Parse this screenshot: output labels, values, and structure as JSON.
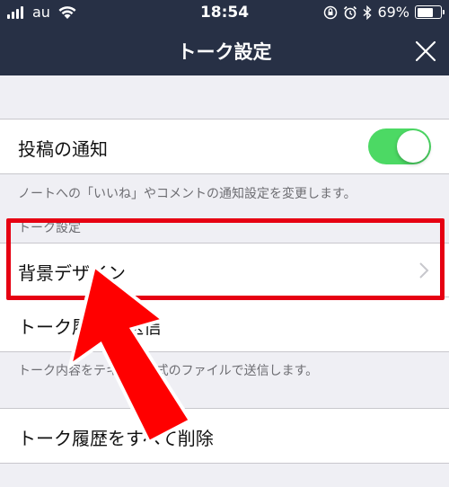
{
  "status_bar": {
    "carrier": "au",
    "time": "18:54",
    "battery": "69%",
    "battery_level": 0.69
  },
  "nav": {
    "title": "トーク設定"
  },
  "settings": {
    "post_notification_label": "投稿の通知",
    "post_notification_enabled": true,
    "post_notification_note": "ノートへの「いいね」やコメントの通知設定を変更します。",
    "section_header": "トーク設定",
    "background_design_label": "背景デザイン",
    "send_history_label": "トーク履歴を送信",
    "send_history_note": "トーク内容をテキスト形式のファイルで送信します。",
    "delete_history_label": "トーク履歴をすべて削除"
  },
  "colors": {
    "nav_bg": "#273045",
    "toggle_on": "#4cd964",
    "highlight": "#e60012"
  }
}
